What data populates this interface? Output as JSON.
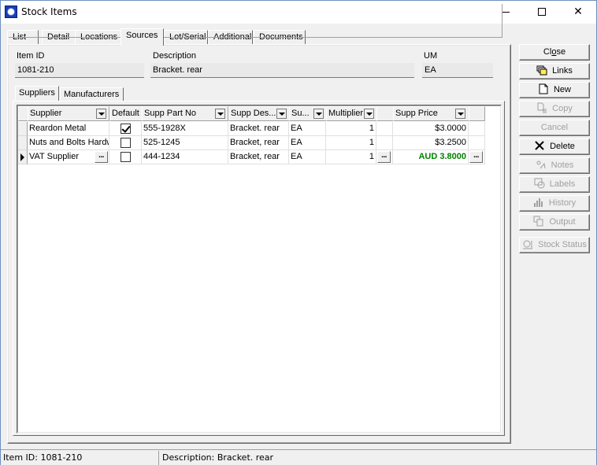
{
  "window": {
    "title": "Stock Items",
    "controls": [
      "minimize",
      "maximize",
      "close"
    ]
  },
  "tabs": [
    {
      "label": "List",
      "active": false
    },
    {
      "label": "Detail",
      "active": false
    },
    {
      "label": "Locations",
      "active": false
    },
    {
      "label": "Sources",
      "active": true
    },
    {
      "label": "Lot/Serial",
      "active": false
    },
    {
      "label": "Additional",
      "active": false
    },
    {
      "label": "Documents",
      "active": false
    }
  ],
  "header": {
    "item_id_label": "Item ID",
    "item_id_value": "1081-210",
    "description_label": "Description",
    "description_value": "Bracket. rear",
    "um_label": "UM",
    "um_value": "EA"
  },
  "subtabs": [
    {
      "label": "Suppliers",
      "active": true
    },
    {
      "label": "Manufacturers",
      "active": false
    }
  ],
  "grid": {
    "columns": [
      "Supplier",
      "Default",
      "Supp Part No",
      "Supp Des...",
      "Su...",
      "Multiplier",
      "",
      "Supp Price",
      ""
    ],
    "rows": [
      {
        "supplier": "Reardon Metal",
        "default": true,
        "part_no": "555-1928X",
        "desc": "Bracket. rear",
        "um": "EA",
        "multiplier": "1",
        "price": "$3.0000",
        "current": false,
        "price_highlight": false
      },
      {
        "supplier": "Nuts and Bolts Hardw",
        "default": false,
        "part_no": "525-1245",
        "desc": "Bracket, rear",
        "um": "EA",
        "multiplier": "1",
        "price": "$3.2500",
        "current": false,
        "price_highlight": false
      },
      {
        "supplier": "VAT Supplier",
        "default": false,
        "part_no": "444-1234",
        "desc": "Bracket, rear",
        "um": "EA",
        "multiplier": "1",
        "price": "AUD 3.8000",
        "current": true,
        "price_highlight": true
      }
    ],
    "ellipsis_label": "..."
  },
  "buttons": {
    "close": "Close",
    "links": "Links",
    "new": "New",
    "copy": "Copy",
    "cancel": "Cancel",
    "delete": "Delete",
    "notes": "Notes",
    "labels": "Labels",
    "history": "History",
    "output": "Output",
    "stock_status": "Stock Status"
  },
  "statusbar": {
    "item": "Item ID: 1081-210",
    "description": "Description: Bracket. rear"
  },
  "colors": {
    "highlight_price": "#008000",
    "disabled_text": "#a0a0a0",
    "window_border": "#6e8fbf"
  }
}
